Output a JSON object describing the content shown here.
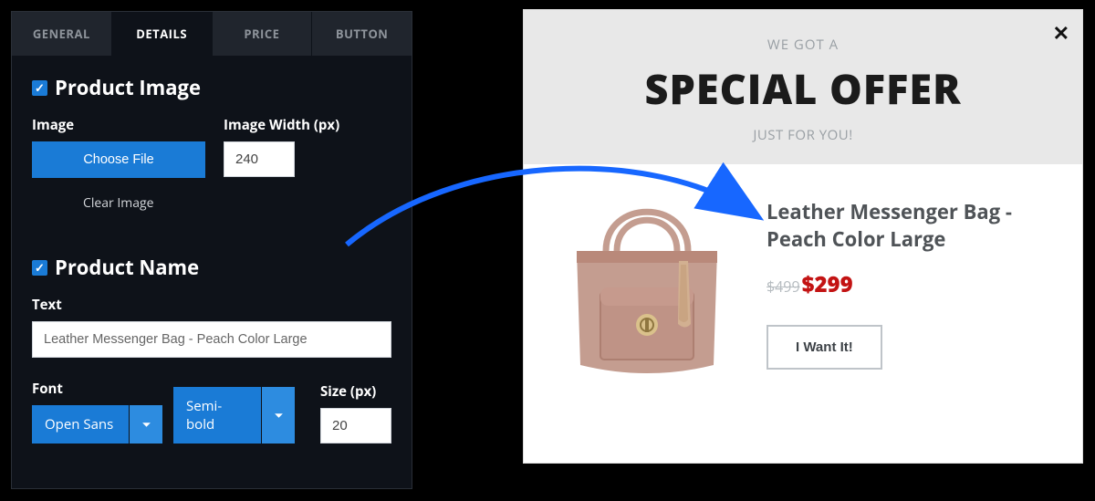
{
  "tabs": {
    "general": "GENERAL",
    "details": "DETAILS",
    "price": "PRICE",
    "button": "BUTTON"
  },
  "section_product_image": {
    "title": "Product Image",
    "image_label": "Image",
    "choose_file": "Choose File",
    "clear_image": "Clear Image",
    "image_width_label": "Image Width (px)",
    "image_width_value": "240"
  },
  "section_product_name": {
    "title": "Product Name",
    "text_label": "Text",
    "text_value": "Leather Messenger Bag - Peach Color Large",
    "font_label": "Font",
    "font_value": "Open Sans",
    "weight_value": "Semi-bold",
    "size_label": "Size (px)",
    "size_value": "20"
  },
  "preview": {
    "eyebrow": "WE GOT A",
    "headline": "SPECIAL OFFER",
    "subline": "JUST FOR YOU!",
    "product_name": "Leather Messenger Bag - Peach Color Large",
    "old_price": "$499",
    "new_price": "$299",
    "cta": "I Want It!",
    "close": "✕"
  }
}
